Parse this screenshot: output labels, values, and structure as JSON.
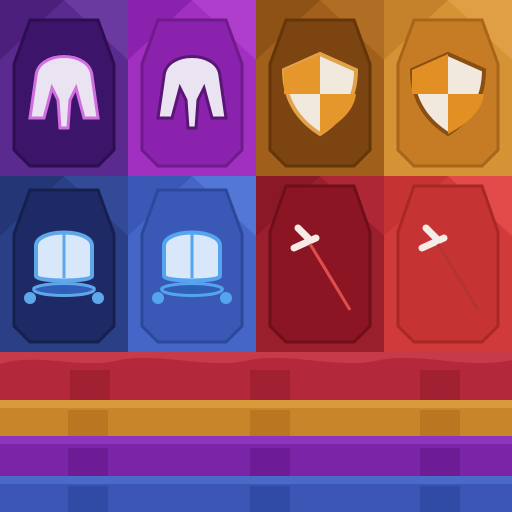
{
  "sheet": {
    "palette": {
      "dark_purple": "#4a1a86",
      "purple": "#8a2ab2",
      "dark_orange": "#a5631c",
      "orange": "#d18a2c",
      "dark_blue": "#253f86",
      "blue": "#3d64c7",
      "dark_red": "#9e1a2a",
      "red": "#d33a3a"
    },
    "tiles": [
      {
        "icon": "helmet-icon",
        "variant": "dark",
        "color": "purple"
      },
      {
        "icon": "helmet-icon",
        "variant": "light",
        "color": "purple"
      },
      {
        "icon": "shield-icon",
        "variant": "dark",
        "color": "orange"
      },
      {
        "icon": "shield-icon",
        "variant": "light",
        "color": "orange"
      },
      {
        "icon": "armor-icon",
        "variant": "dark",
        "color": "blue"
      },
      {
        "icon": "armor-icon",
        "variant": "light",
        "color": "blue"
      },
      {
        "icon": "sword-icon",
        "variant": "dark",
        "color": "red"
      },
      {
        "icon": "sword-icon",
        "variant": "light",
        "color": "red"
      }
    ],
    "strips": [
      {
        "color": "red",
        "hex": "#b3283a"
      },
      {
        "color": "orange",
        "hex": "#c9852a"
      },
      {
        "color": "purple",
        "hex": "#7a24a8"
      },
      {
        "color": "blue",
        "hex": "#3b56b5"
      }
    ]
  }
}
